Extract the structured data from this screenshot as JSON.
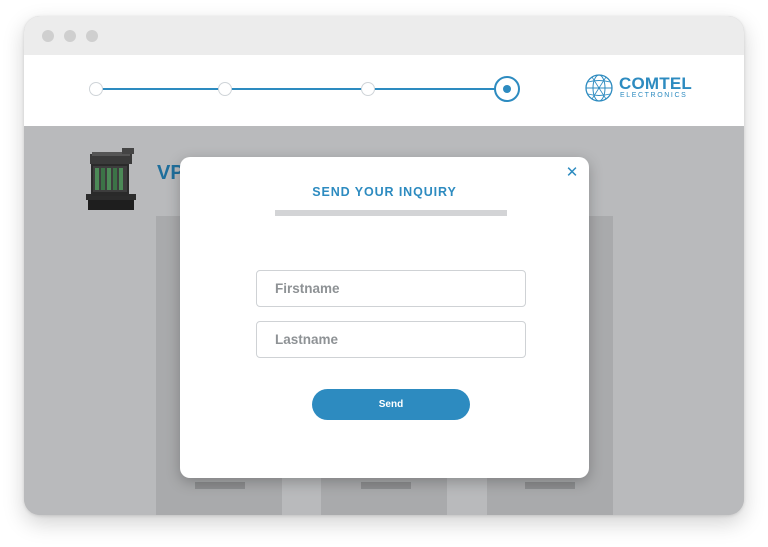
{
  "window": {
    "dots": [
      "window-dot",
      "window-dot",
      "window-dot"
    ]
  },
  "stepper": {
    "steps": 4,
    "active_step": 4
  },
  "logo": {
    "name": "COMTEL",
    "subtitle": "ELECTRONICS",
    "icon": "globe-icon"
  },
  "page": {
    "heading": "VP"
  },
  "modal": {
    "title": "SEND YOUR INQUIRY",
    "close_icon": "close-icon",
    "firstname_placeholder": "Firstname",
    "lastname_placeholder": "Lastname",
    "send_label": "Send"
  },
  "colors": {
    "accent": "#2d8bc0",
    "overlay": "#b9babc",
    "modal_bg": "#ffffff"
  }
}
